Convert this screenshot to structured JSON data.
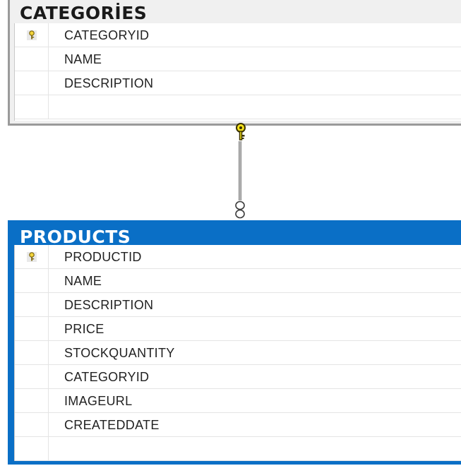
{
  "diagram": {
    "tables": [
      {
        "name": "CATEGORİES",
        "columns": [
          {
            "name": "CATEGORYID",
            "primary_key": true
          },
          {
            "name": "NAME",
            "primary_key": false
          },
          {
            "name": "DESCRIPTION",
            "primary_key": false
          }
        ]
      },
      {
        "name": "PRODUCTS",
        "selected": true,
        "columns": [
          {
            "name": "PRODUCTID",
            "primary_key": true
          },
          {
            "name": "NAME",
            "primary_key": false
          },
          {
            "name": "DESCRIPTION",
            "primary_key": false
          },
          {
            "name": "PRICE",
            "primary_key": false
          },
          {
            "name": "STOCKQUANTITY",
            "primary_key": false
          },
          {
            "name": "CATEGORYID",
            "primary_key": false
          },
          {
            "name": "IMAGEURL",
            "primary_key": false
          },
          {
            "name": "CREATEDDATE",
            "primary_key": false
          }
        ]
      }
    ],
    "relationship": {
      "one_side": "key-icon",
      "many_side": "infinity-icon"
    }
  },
  "colors": {
    "selected_header": "#0a6fc6",
    "unselected_header": "#f0f0f0",
    "key_icon": "#e6c81e",
    "connector": "#bdbdbd"
  }
}
